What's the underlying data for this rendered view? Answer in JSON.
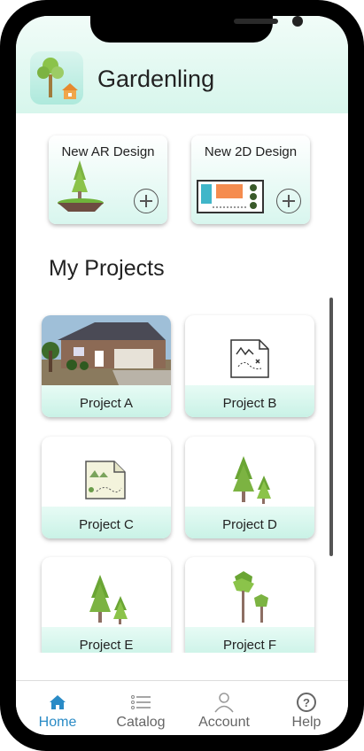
{
  "app": {
    "title": "Gardenling"
  },
  "designs": [
    {
      "label": "New AR Design"
    },
    {
      "label": "New 2D Design"
    }
  ],
  "section_title": "My Projects",
  "projects": [
    {
      "label": "Project A"
    },
    {
      "label": "Project B"
    },
    {
      "label": "Project C"
    },
    {
      "label": "Project D"
    },
    {
      "label": "Project E"
    },
    {
      "label": "Project F"
    }
  ],
  "tabs": [
    {
      "label": "Home",
      "icon": "home-icon"
    },
    {
      "label": "Catalog",
      "icon": "list-icon"
    },
    {
      "label": "Account",
      "icon": "user-icon"
    },
    {
      "label": "Help",
      "icon": "help-icon"
    }
  ],
  "colors": {
    "accent": "#2a8bc6",
    "mint": "#d7f6ec",
    "tab_inactive": "#666666"
  }
}
